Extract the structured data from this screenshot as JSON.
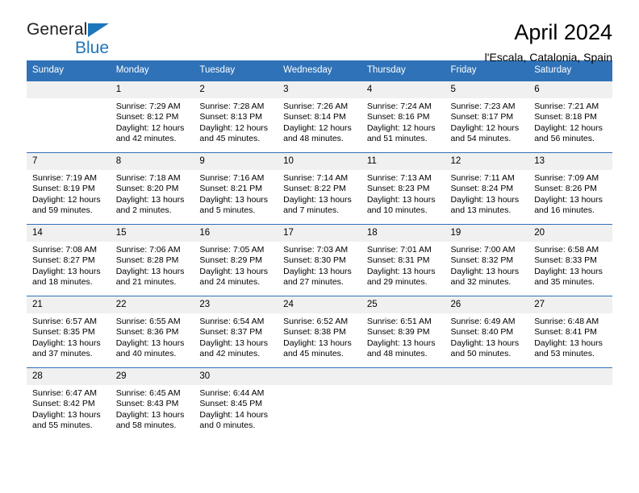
{
  "brand": {
    "line1": "General",
    "line2": "Blue",
    "logo_icon": "triangle-flag-icon"
  },
  "header": {
    "title": "April 2024",
    "subtitle": "l'Escala, Catalonia, Spain"
  },
  "colors": {
    "header_blue": "#2f72b8",
    "brand_blue": "#1c76bc",
    "daynum_bg": "#f0f0f0",
    "cell_bg": "#ffffff",
    "text": "#000000"
  },
  "weekday_headers": [
    "Sunday",
    "Monday",
    "Tuesday",
    "Wednesday",
    "Thursday",
    "Friday",
    "Saturday"
  ],
  "weeks": [
    [
      {
        "day": "",
        "lines": []
      },
      {
        "day": "1",
        "lines": [
          "Sunrise: 7:29 AM",
          "Sunset: 8:12 PM",
          "Daylight: 12 hours",
          "and 42 minutes."
        ]
      },
      {
        "day": "2",
        "lines": [
          "Sunrise: 7:28 AM",
          "Sunset: 8:13 PM",
          "Daylight: 12 hours",
          "and 45 minutes."
        ]
      },
      {
        "day": "3",
        "lines": [
          "Sunrise: 7:26 AM",
          "Sunset: 8:14 PM",
          "Daylight: 12 hours",
          "and 48 minutes."
        ]
      },
      {
        "day": "4",
        "lines": [
          "Sunrise: 7:24 AM",
          "Sunset: 8:16 PM",
          "Daylight: 12 hours",
          "and 51 minutes."
        ]
      },
      {
        "day": "5",
        "lines": [
          "Sunrise: 7:23 AM",
          "Sunset: 8:17 PM",
          "Daylight: 12 hours",
          "and 54 minutes."
        ]
      },
      {
        "day": "6",
        "lines": [
          "Sunrise: 7:21 AM",
          "Sunset: 8:18 PM",
          "Daylight: 12 hours",
          "and 56 minutes."
        ]
      }
    ],
    [
      {
        "day": "7",
        "lines": [
          "Sunrise: 7:19 AM",
          "Sunset: 8:19 PM",
          "Daylight: 12 hours",
          "and 59 minutes."
        ]
      },
      {
        "day": "8",
        "lines": [
          "Sunrise: 7:18 AM",
          "Sunset: 8:20 PM",
          "Daylight: 13 hours",
          "and 2 minutes."
        ]
      },
      {
        "day": "9",
        "lines": [
          "Sunrise: 7:16 AM",
          "Sunset: 8:21 PM",
          "Daylight: 13 hours",
          "and 5 minutes."
        ]
      },
      {
        "day": "10",
        "lines": [
          "Sunrise: 7:14 AM",
          "Sunset: 8:22 PM",
          "Daylight: 13 hours",
          "and 7 minutes."
        ]
      },
      {
        "day": "11",
        "lines": [
          "Sunrise: 7:13 AM",
          "Sunset: 8:23 PM",
          "Daylight: 13 hours",
          "and 10 minutes."
        ]
      },
      {
        "day": "12",
        "lines": [
          "Sunrise: 7:11 AM",
          "Sunset: 8:24 PM",
          "Daylight: 13 hours",
          "and 13 minutes."
        ]
      },
      {
        "day": "13",
        "lines": [
          "Sunrise: 7:09 AM",
          "Sunset: 8:26 PM",
          "Daylight: 13 hours",
          "and 16 minutes."
        ]
      }
    ],
    [
      {
        "day": "14",
        "lines": [
          "Sunrise: 7:08 AM",
          "Sunset: 8:27 PM",
          "Daylight: 13 hours",
          "and 18 minutes."
        ]
      },
      {
        "day": "15",
        "lines": [
          "Sunrise: 7:06 AM",
          "Sunset: 8:28 PM",
          "Daylight: 13 hours",
          "and 21 minutes."
        ]
      },
      {
        "day": "16",
        "lines": [
          "Sunrise: 7:05 AM",
          "Sunset: 8:29 PM",
          "Daylight: 13 hours",
          "and 24 minutes."
        ]
      },
      {
        "day": "17",
        "lines": [
          "Sunrise: 7:03 AM",
          "Sunset: 8:30 PM",
          "Daylight: 13 hours",
          "and 27 minutes."
        ]
      },
      {
        "day": "18",
        "lines": [
          "Sunrise: 7:01 AM",
          "Sunset: 8:31 PM",
          "Daylight: 13 hours",
          "and 29 minutes."
        ]
      },
      {
        "day": "19",
        "lines": [
          "Sunrise: 7:00 AM",
          "Sunset: 8:32 PM",
          "Daylight: 13 hours",
          "and 32 minutes."
        ]
      },
      {
        "day": "20",
        "lines": [
          "Sunrise: 6:58 AM",
          "Sunset: 8:33 PM",
          "Daylight: 13 hours",
          "and 35 minutes."
        ]
      }
    ],
    [
      {
        "day": "21",
        "lines": [
          "Sunrise: 6:57 AM",
          "Sunset: 8:35 PM",
          "Daylight: 13 hours",
          "and 37 minutes."
        ]
      },
      {
        "day": "22",
        "lines": [
          "Sunrise: 6:55 AM",
          "Sunset: 8:36 PM",
          "Daylight: 13 hours",
          "and 40 minutes."
        ]
      },
      {
        "day": "23",
        "lines": [
          "Sunrise: 6:54 AM",
          "Sunset: 8:37 PM",
          "Daylight: 13 hours",
          "and 42 minutes."
        ]
      },
      {
        "day": "24",
        "lines": [
          "Sunrise: 6:52 AM",
          "Sunset: 8:38 PM",
          "Daylight: 13 hours",
          "and 45 minutes."
        ]
      },
      {
        "day": "25",
        "lines": [
          "Sunrise: 6:51 AM",
          "Sunset: 8:39 PM",
          "Daylight: 13 hours",
          "and 48 minutes."
        ]
      },
      {
        "day": "26",
        "lines": [
          "Sunrise: 6:49 AM",
          "Sunset: 8:40 PM",
          "Daylight: 13 hours",
          "and 50 minutes."
        ]
      },
      {
        "day": "27",
        "lines": [
          "Sunrise: 6:48 AM",
          "Sunset: 8:41 PM",
          "Daylight: 13 hours",
          "and 53 minutes."
        ]
      }
    ],
    [
      {
        "day": "28",
        "lines": [
          "Sunrise: 6:47 AM",
          "Sunset: 8:42 PM",
          "Daylight: 13 hours",
          "and 55 minutes."
        ]
      },
      {
        "day": "29",
        "lines": [
          "Sunrise: 6:45 AM",
          "Sunset: 8:43 PM",
          "Daylight: 13 hours",
          "and 58 minutes."
        ]
      },
      {
        "day": "30",
        "lines": [
          "Sunrise: 6:44 AM",
          "Sunset: 8:45 PM",
          "Daylight: 14 hours",
          "and 0 minutes."
        ]
      },
      {
        "day": "",
        "lines": []
      },
      {
        "day": "",
        "lines": []
      },
      {
        "day": "",
        "lines": []
      },
      {
        "day": "",
        "lines": []
      }
    ]
  ]
}
